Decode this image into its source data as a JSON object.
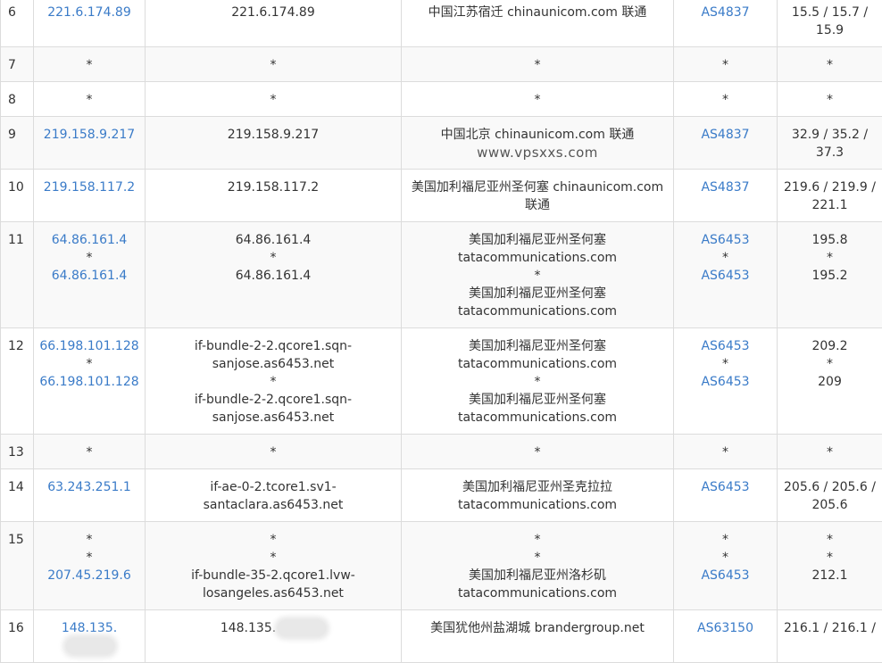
{
  "rows": [
    {
      "hop": "6",
      "ip": [
        "221.6.174.89"
      ],
      "host": [
        "221.6.174.89"
      ],
      "location": [
        "中国江苏宿迁 chinaunicom.com 联通"
      ],
      "asn": [
        "AS4837"
      ],
      "latency": [
        "15.5 / 15.7 /",
        "15.9"
      ]
    },
    {
      "hop": "7",
      "ip": [
        "*"
      ],
      "host": [
        "*"
      ],
      "location": [
        "*"
      ],
      "asn": [
        "*"
      ],
      "latency": [
        "*"
      ]
    },
    {
      "hop": "8",
      "ip": [
        "*"
      ],
      "host": [
        "*"
      ],
      "location": [
        "*"
      ],
      "asn": [
        "*"
      ],
      "latency": [
        "*"
      ]
    },
    {
      "hop": "9",
      "ip": [
        "219.158.9.217"
      ],
      "host": [
        "219.158.9.217"
      ],
      "location": [
        "中国北京 chinaunicom.com 联通"
      ],
      "watermark": "www.vpsxxs.com",
      "asn": [
        "AS4837"
      ],
      "latency": [
        "32.9 / 35.2 /",
        "37.3"
      ]
    },
    {
      "hop": "10",
      "ip": [
        "219.158.117.2"
      ],
      "host": [
        "219.158.117.2"
      ],
      "location": [
        "美国加利福尼亚州圣何塞 chinaunicom.com",
        "联通"
      ],
      "asn": [
        "AS4837"
      ],
      "latency": [
        "219.6 / 219.9 /",
        "221.1"
      ]
    },
    {
      "hop": "11",
      "ip": [
        "64.86.161.4",
        "*",
        "64.86.161.4"
      ],
      "host": [
        "64.86.161.4",
        "*",
        "64.86.161.4"
      ],
      "location": [
        "美国加利福尼亚州圣何塞",
        "tatacommunications.com",
        "*",
        "美国加利福尼亚州圣何塞",
        "tatacommunications.com"
      ],
      "asn": [
        "AS6453",
        "*",
        "AS6453"
      ],
      "latency": [
        "195.8",
        "*",
        "195.2"
      ]
    },
    {
      "hop": "12",
      "ip": [
        "66.198.101.128",
        "*",
        "66.198.101.128"
      ],
      "host": [
        "if-bundle-2-2.qcore1.sqn-",
        "sanjose.as6453.net",
        "*",
        "if-bundle-2-2.qcore1.sqn-",
        "sanjose.as6453.net"
      ],
      "location": [
        "美国加利福尼亚州圣何塞",
        "tatacommunications.com",
        "*",
        "美国加利福尼亚州圣何塞",
        "tatacommunications.com"
      ],
      "asn": [
        "AS6453",
        "*",
        "AS6453"
      ],
      "latency": [
        "209.2",
        "*",
        "209"
      ]
    },
    {
      "hop": "13",
      "ip": [
        "*"
      ],
      "host": [
        "*"
      ],
      "location": [
        "*"
      ],
      "asn": [
        "*"
      ],
      "latency": [
        "*"
      ]
    },
    {
      "hop": "14",
      "ip": [
        "63.243.251.1"
      ],
      "host": [
        "if-ae-0-2.tcore1.sv1-",
        "santaclara.as6453.net"
      ],
      "location": [
        "美国加利福尼亚州圣克拉拉",
        "tatacommunications.com"
      ],
      "asn": [
        "AS6453"
      ],
      "latency": [
        "205.6 / 205.6 /",
        "205.6"
      ]
    },
    {
      "hop": "15",
      "ip": [
        "*",
        "*",
        "207.45.219.6"
      ],
      "host": [
        "*",
        "*",
        "if-bundle-35-2.qcore1.lvw-",
        "losangeles.as6453.net"
      ],
      "location": [
        "*",
        "*",
        "美国加利福尼亚州洛杉矶",
        "tatacommunications.com"
      ],
      "asn": [
        "*",
        "*",
        "AS6453"
      ],
      "latency": [
        "*",
        "*",
        "212.1"
      ]
    },
    {
      "hop": "16",
      "ip": [
        "148.135."
      ],
      "host": [
        "148.135."
      ],
      "location": [
        "美国犹他州盐湖城 brandergroup.net"
      ],
      "asn": [
        "AS63150"
      ],
      "latency": [
        "216.1 / 216.1 /"
      ],
      "masked": true
    }
  ]
}
